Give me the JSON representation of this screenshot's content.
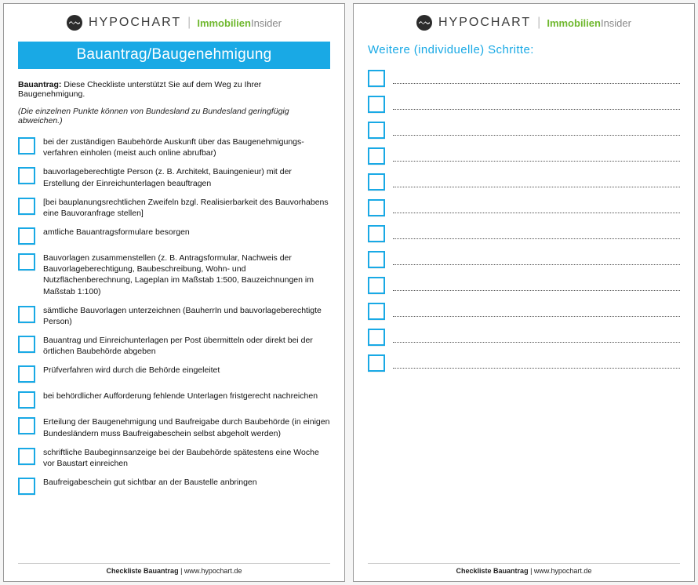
{
  "brand": {
    "name": "HYPOCHART",
    "sub_green": "Immobilien",
    "sub_grey": "Insider"
  },
  "page1": {
    "title": "Bauantrag/Baugenehmigung",
    "intro_bold": "Bauantrag:",
    "intro_rest": " Diese Checkliste unterstützt Sie auf dem Weg zu Ihrer Baugenehmigung.",
    "note": "(Die einzelnen Punkte können von Bundesland zu Bundesland geringfügig abweichen.)",
    "items": [
      "bei der zuständigen Baubehörde Auskunft über das Baugenehmigungs-verfahren einholen (meist auch online abrufbar)",
      "bauvorlageberechtigte Person (z. B. Architekt, Bauingenieur) mit der Erstellung der Einreichunterlagen beauftragen",
      "[bei bauplanungsrechtlichen Zweifeln bzgl. Realisierbarkeit des Bauvorhabens eine Bauvoranfrage stellen]",
      "amtliche Bauantragsformulare besorgen",
      "Bauvorlagen zusammenstellen (z. B. Antragsformular, Nachweis der Bauvorlageberechtigung, Baubeschreibung, Wohn- und Nutzflächenberechnung, Lageplan im Maßstab 1:500, Bauzeichnungen im Maßstab 1:100)",
      "sämtliche Bauvorlagen unterzeichnen (BauherrIn und bauvorlageberechtigte Person)",
      "Bauantrag und Einreichunterlagen per Post übermitteln oder direkt bei der örtlichen Baubehörde abgeben",
      "Prüfverfahren wird durch die Behörde eingeleitet",
      "bei behördlicher Aufforderung fehlende Unterlagen fristgerecht nachreichen",
      "Erteilung der Baugenehmigung und Baufreigabe durch Baubehörde (in einigen Bundesländern muss Baufreigabeschein selbst abgeholt werden)",
      "schriftliche Baubeginnsanzeige bei der Baubehörde spätestens eine Woche vor Baustart einreichen",
      "Baufreigabeschein gut sichtbar an der Baustelle anbringen"
    ]
  },
  "page2": {
    "section_title": "Weitere (individuelle) Schritte:",
    "blank_count": 12
  },
  "footer": {
    "bold": "Checkliste Bauantrag",
    "sep": " | ",
    "url": "www.hypochart.de"
  }
}
